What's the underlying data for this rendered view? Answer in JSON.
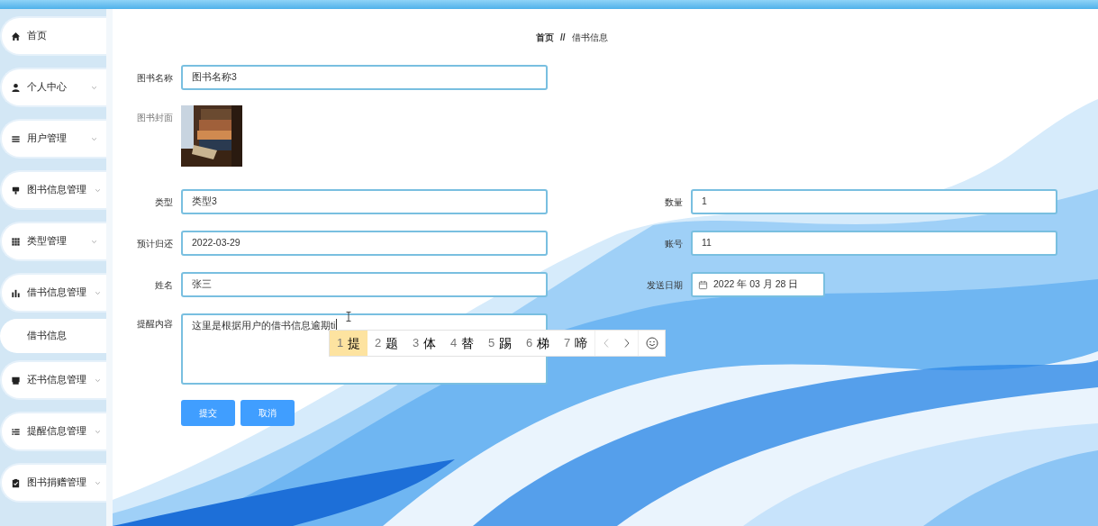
{
  "sidebar": {
    "items": [
      {
        "label": "首页",
        "has_submenu": false
      },
      {
        "label": "个人中心",
        "has_submenu": true
      },
      {
        "label": "用户管理",
        "has_submenu": true
      },
      {
        "label": "图书信息管理",
        "has_submenu": true
      },
      {
        "label": "类型管理",
        "has_submenu": true
      },
      {
        "label": "借书信息管理",
        "has_submenu": true,
        "children": [
          {
            "label": "借书信息"
          }
        ]
      },
      {
        "label": "还书信息管理",
        "has_submenu": true
      },
      {
        "label": "提醒信息管理",
        "has_submenu": true
      },
      {
        "label": "图书捐赠管理",
        "has_submenu": true
      }
    ]
  },
  "breadcrumb": [
    {
      "label": "首页",
      "bold": true
    },
    {
      "label": "借书信息",
      "bold": false
    }
  ],
  "breadcrumb_separator": "//",
  "form": {
    "title_field": {
      "label": "图书名称",
      "value": "图书名称3"
    },
    "cover": {
      "label": "图书封面",
      "kind": "picture"
    },
    "rows": [
      [
        {
          "label": "类型",
          "value": "类型3",
          "kind": "text"
        },
        {
          "label": "数量",
          "value": "1",
          "kind": "text"
        }
      ],
      [
        {
          "label": "预计归还",
          "value": "2022-03-29",
          "kind": "text"
        },
        {
          "label": "账号",
          "value": "11",
          "kind": "text"
        }
      ],
      [
        {
          "label": "姓名",
          "value": "张三",
          "kind": "text"
        },
        {
          "label": "发送日期",
          "value": "2022 年 03 月 28 日",
          "kind": "date"
        }
      ]
    ],
    "content": {
      "label": "提醒内容",
      "value": "这里是根据用户的借书信息逾期",
      "composition": "ti"
    },
    "buttons": [
      "提交",
      "取消"
    ]
  },
  "ime": {
    "candidates": [
      {
        "number": "1",
        "text": "提",
        "selected": true
      },
      {
        "number": "2",
        "text": "题",
        "selected": false
      },
      {
        "number": "3",
        "text": "体",
        "selected": false
      },
      {
        "number": "4",
        "text": "替",
        "selected": false
      },
      {
        "number": "5",
        "text": "踢",
        "selected": false
      },
      {
        "number": "6",
        "text": "梯",
        "selected": false
      },
      {
        "number": "7",
        "text": "啼",
        "selected": false
      }
    ]
  }
}
